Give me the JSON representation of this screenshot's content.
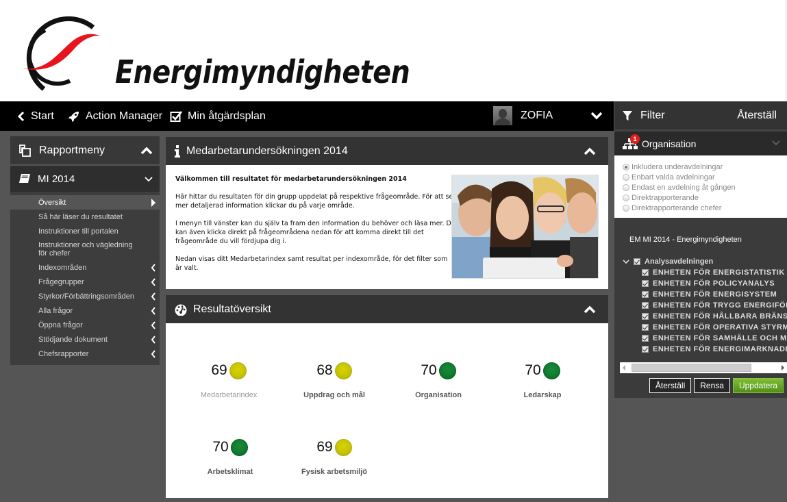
{
  "brand": {
    "name": "Energimyndigheten",
    "accent_red": "#e0201a"
  },
  "topnav": {
    "start_label": "Start",
    "action_manager_label": "Action Manager",
    "plan_label": "Min åtgärdsplan",
    "user_name": "ZOFIA"
  },
  "filter": {
    "title": "Filter",
    "reset_label": "Återställ",
    "organisation": {
      "title": "Organisation",
      "badge_count": "1",
      "options": [
        {
          "label": "Inkludera underavdelningar",
          "checked": true
        },
        {
          "label": "Enbart valda avdelningar",
          "checked": false
        },
        {
          "label": "Endast en avdelning åt gången",
          "checked": false
        },
        {
          "label": "Direktrapporterande",
          "checked": false
        },
        {
          "label": "Direktrapporterande chefer",
          "checked": false
        }
      ],
      "tree_title": "EM MI 2014 - Energimyndigheten",
      "root": {
        "label": "Analysavdelningen",
        "checked": true
      },
      "children": [
        "ENHETEN FÖR ENERGISTATISTIK",
        "ENHETEN FÖR POLICYANALYS",
        "ENHETEN FÖR ENERGISYSTEM",
        "ENHETEN FÖR TRYGG ENERGIFÖRSÖRJNING",
        "ENHETEN FÖR HÅLLBARA BRÄNSLEN",
        "ENHETEN FÖR OPERATIVA STYRMEDEL",
        "ENHETEN FÖR SAMHÄLLE OCH MILJÖ",
        "ENHETEN FÖR ENERGIMARKNADER"
      ]
    },
    "buttons": {
      "reset": "Återställ",
      "clear": "Rensa",
      "update": "Uppdatera"
    }
  },
  "sidebar": {
    "menu_title": "Rapportmeny",
    "section_title": "MI 2014",
    "items": [
      {
        "label": "Översikt",
        "active": true,
        "expandable": false
      },
      {
        "label": "Så här läser du resultatet",
        "active": false,
        "expandable": false
      },
      {
        "label": "Instruktioner till portalen",
        "active": false,
        "expandable": false
      },
      {
        "label": "Instruktioner och vägledning för chefer",
        "active": false,
        "expandable": false
      },
      {
        "label": "Indexområden",
        "active": false,
        "expandable": true
      },
      {
        "label": "Frågegrupper",
        "active": false,
        "expandable": true
      },
      {
        "label": "Styrkor/Förbättringsområden",
        "active": false,
        "expandable": true
      },
      {
        "label": "Alla frågor",
        "active": false,
        "expandable": true
      },
      {
        "label": "Öppna frågor",
        "active": false,
        "expandable": true
      },
      {
        "label": "Stödjande dokument",
        "active": false,
        "expandable": true
      },
      {
        "label": "Chefsrapporter",
        "active": false,
        "expandable": true
      }
    ]
  },
  "intro": {
    "title": "Medarbetarundersökningen 2014",
    "lead": "Välkommen till resultatet för medarbetarundersökningen 2014",
    "p1": "Här hittar du resultaten för din grupp uppdelat på respektive frågeområde. För att se mer detaljerad information klickar du på varje område.",
    "p2": "I menyn till vänster kan du själv ta fram den information du behöver och läsa mer. Du kan även klicka direkt på frågeområdena nedan för att komma direkt till det frågeområde du vill fördjupa dig i.",
    "p3": "Nedan visas ditt Medarbetarindex samt resultat per indexområde, för det filter som är valt.",
    "image_alt": "Fyra personer som tittar på en surfplatta"
  },
  "results": {
    "title": "Resultatöversikt",
    "status_colors": {
      "yellow": "#c8c400",
      "green": "#0f7a2e"
    },
    "metrics": [
      {
        "label": "Medarbetarindex",
        "value": "69",
        "status": "yellow"
      },
      {
        "label": "Uppdrag och mål",
        "value": "68",
        "status": "yellow"
      },
      {
        "label": "Organisation",
        "value": "70",
        "status": "green"
      },
      {
        "label": "Ledarskap",
        "value": "70",
        "status": "green"
      },
      {
        "label": "Arbetsklimat",
        "value": "70",
        "status": "green"
      },
      {
        "label": "Fysisk arbetsmiljö",
        "value": "69",
        "status": "yellow"
      }
    ]
  }
}
